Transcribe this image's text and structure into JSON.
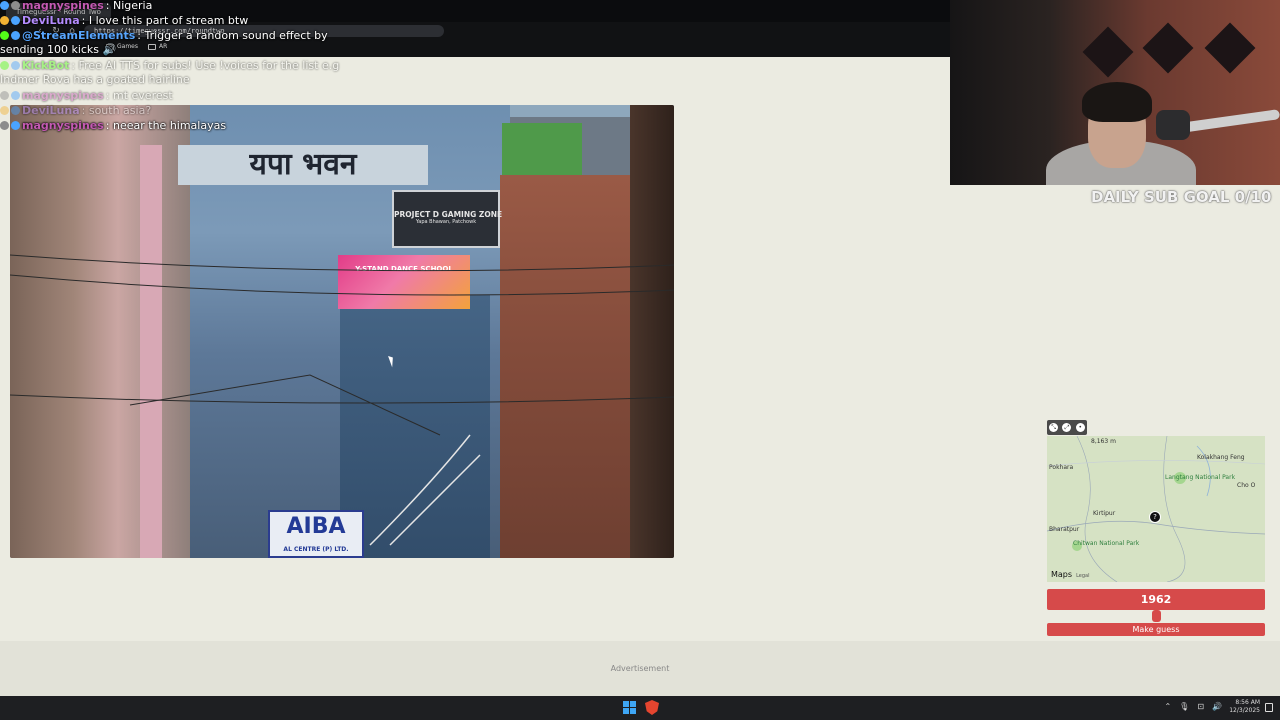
{
  "browser": {
    "tab_title": "Timeguessr - Round Two",
    "url": "https://timeguessr.com/roundtwo",
    "nav_back": "‹",
    "nav_reload": "↻",
    "nav_home": "⌂",
    "bookmarks": [
      {
        "label": "Games"
      },
      {
        "label": "AR"
      }
    ]
  },
  "street_view": {
    "hindi_sign": "यपा भवन",
    "gaming_sign_title": "PROJECT D GAMING ZONE",
    "gaming_sign_sub": "Yapa Bhawan, Patchowk",
    "dance_sign": "Y-STAND DANCE SCHOOL",
    "aiba_sign": "AIBA",
    "aiba_sub": "AL CENTRE (P) LTD."
  },
  "chat": {
    "lines": [
      {
        "user": "magnyspines",
        "user_color": "#c45ab3",
        "text": ": Nigeria",
        "faded": false
      },
      {
        "user": "DeviLuna",
        "user_color": "#b58cff",
        "text": ": I love this part of stream btw",
        "faded": false
      },
      {
        "user": "@StreamElements",
        "user_color": "#58a6ff",
        "text": ": Trigger a random sound effect by",
        "faded": false
      },
      {
        "user": "",
        "user_color": "#ffffff",
        "text": "sending 100 kicks 🔊",
        "faded": false
      },
      {
        "user": "KickBot",
        "user_color": "#53fc18",
        "text": ": Free AI TTS for subs! Use !voices for the list e.g",
        "faded": true
      },
      {
        "user": "",
        "user_color": "#ffffff",
        "text": "Indmer Rova has a goated hairline",
        "faded": true
      },
      {
        "user": "magnyspines",
        "user_color": "#c45ab3",
        "text": ": mt everest",
        "faded": true
      },
      {
        "user": "DeviLuna",
        "user_color": "#b58cff",
        "text": ": south asia?",
        "faded": true
      },
      {
        "user": "magnyspines",
        "user_color": "#c45ab3",
        "text": ": neear the himalayas",
        "faded": false
      }
    ]
  },
  "overlay": {
    "sub_goal": "DAILY SUB GOAL 0/10"
  },
  "map": {
    "labels": [
      {
        "text": "Pokhara",
        "green": false
      },
      {
        "text": "Langtang National Park",
        "green": true
      },
      {
        "text": "Kirtipur",
        "green": false
      },
      {
        "text": "Bharatpur",
        "green": false
      },
      {
        "text": "Chitwan National Park",
        "green": true
      },
      {
        "text": "Kolakhang Feng",
        "green": false
      },
      {
        "text": "Cho O",
        "green": false
      },
      {
        "text": "8,163 m",
        "green": false
      }
    ],
    "brand": "Maps",
    "legal": "Legal",
    "pin_glyph": "?"
  },
  "game": {
    "year_value": "1962",
    "slider_fraction": 0.5,
    "guess_button": "Make guess"
  },
  "ad": {
    "label": "Advertisement"
  },
  "taskbar": {
    "tray_icons": [
      "⌃",
      "🎙",
      "⊡",
      "🔊"
    ],
    "time": "8:56 AM",
    "date": "12/3/2025"
  },
  "colors": {
    "accent": "#d64a4a",
    "page_bg": "#ebebe1"
  }
}
